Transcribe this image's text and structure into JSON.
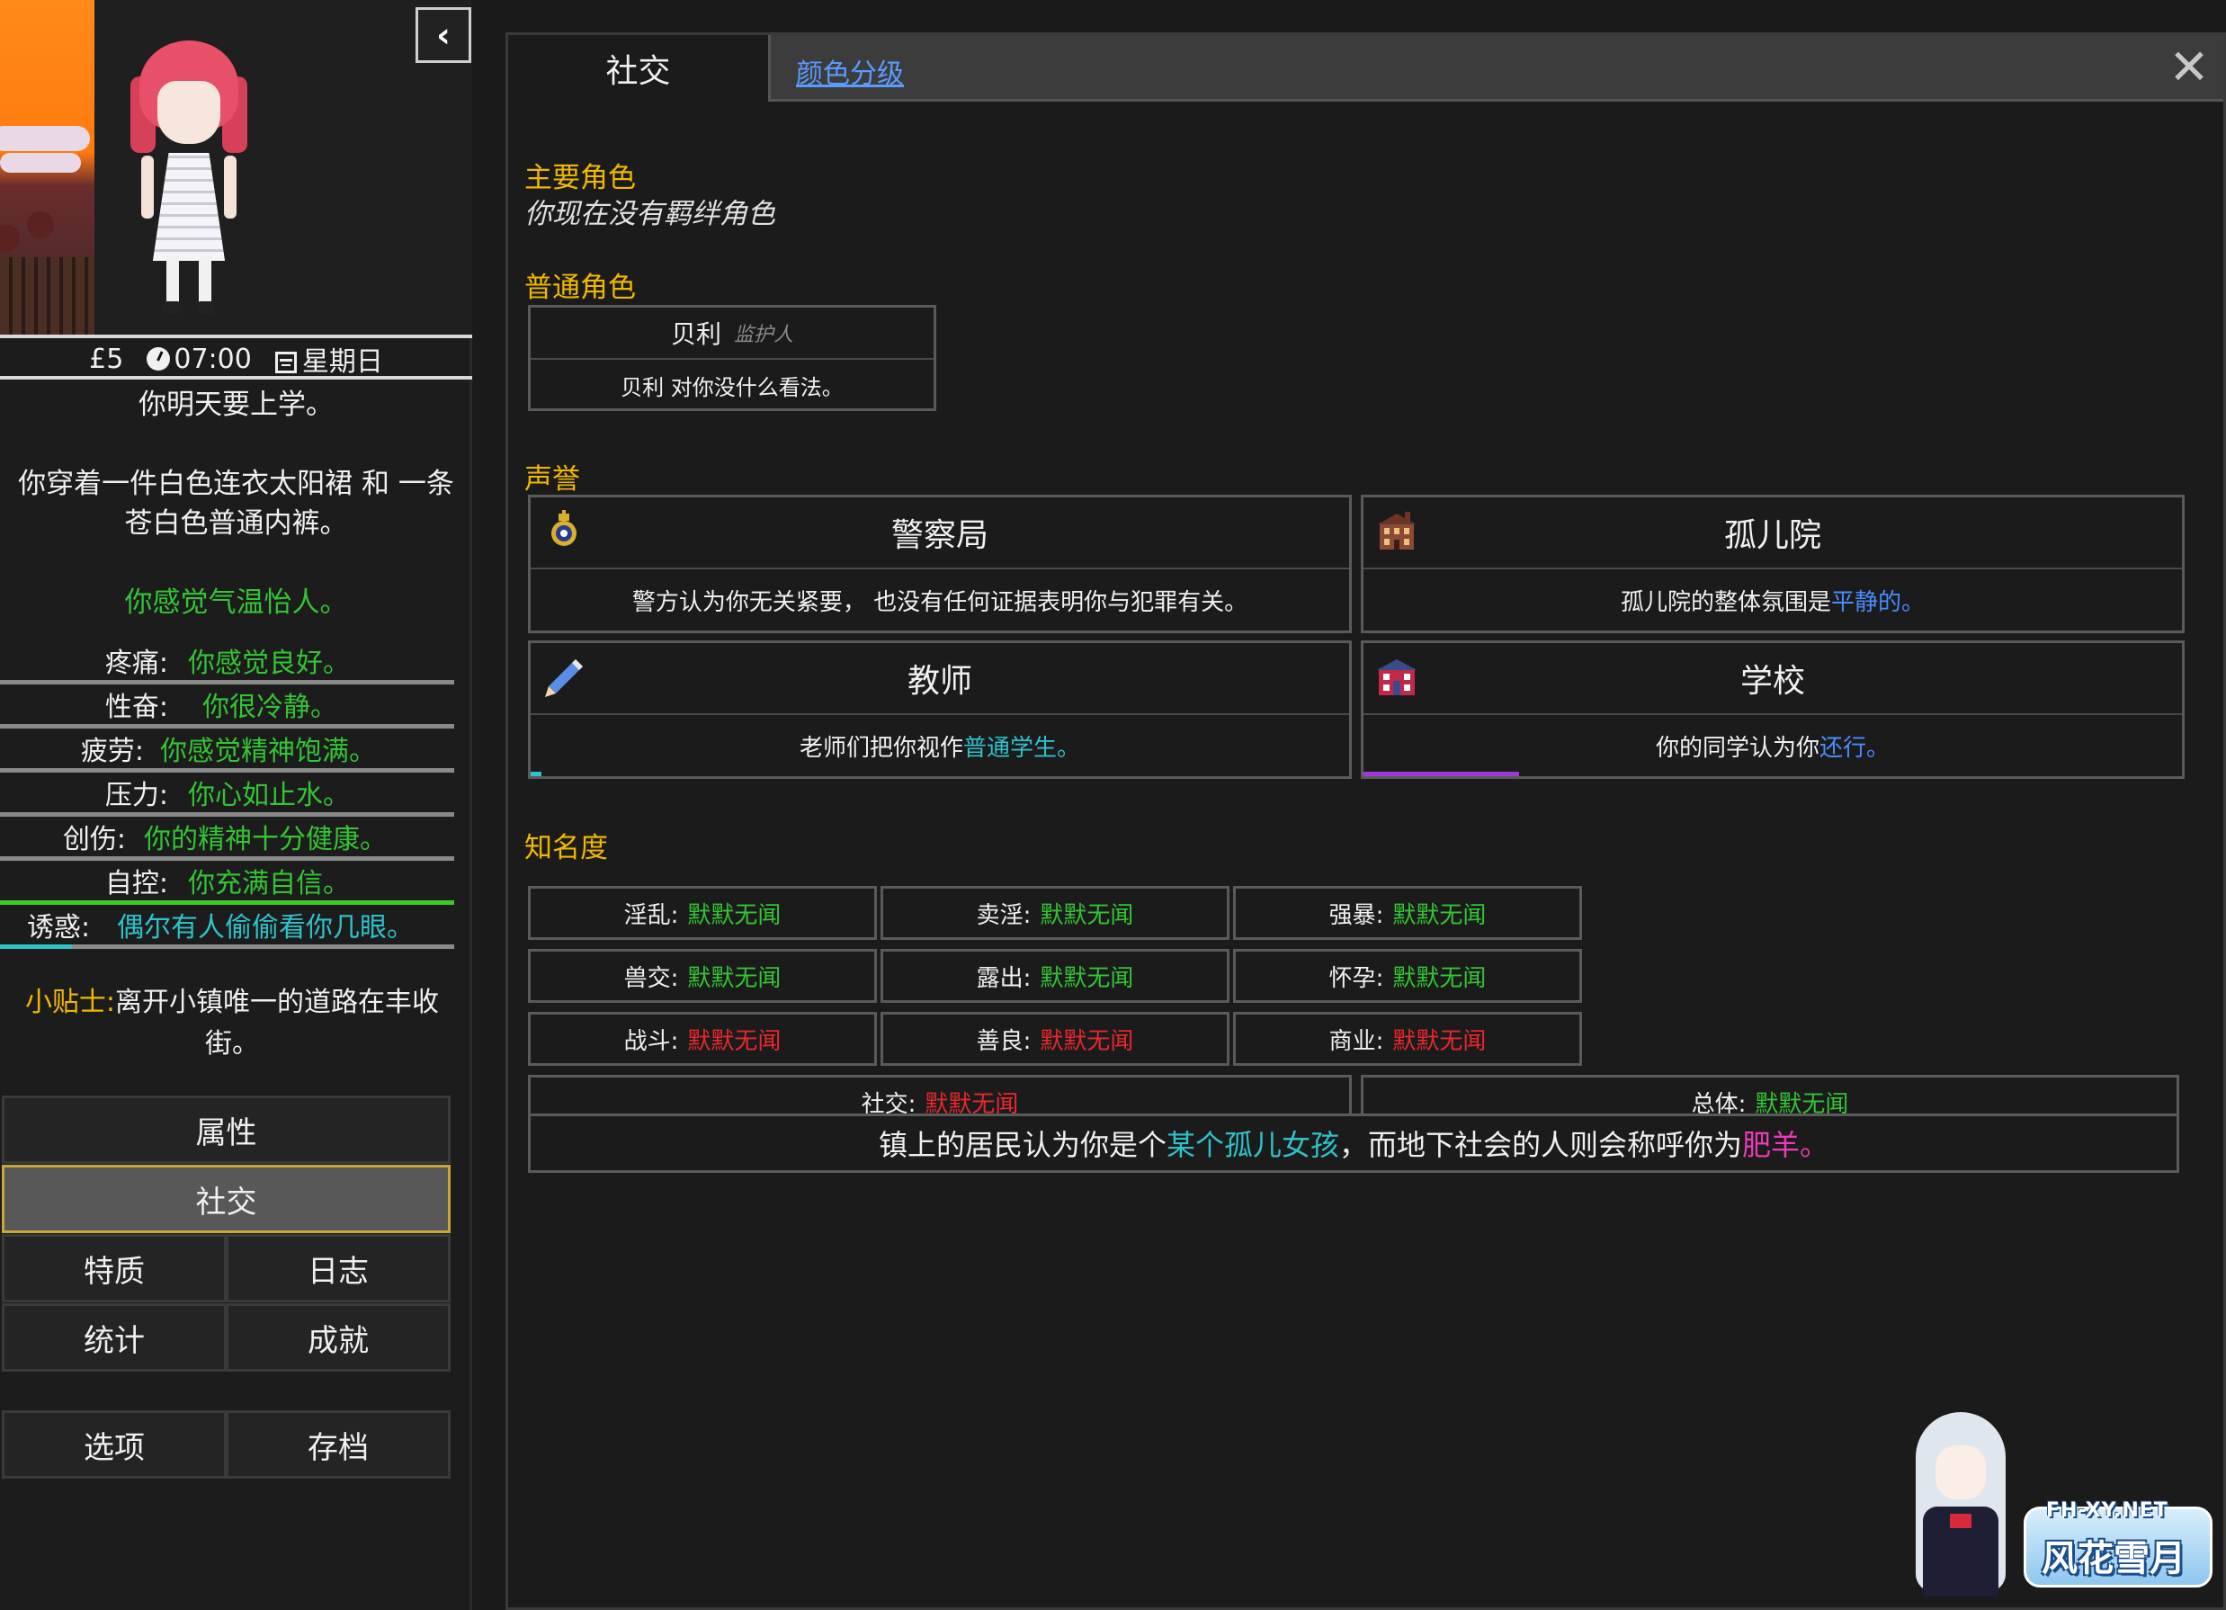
{
  "status": {
    "money": "£5",
    "time": "07:00",
    "weekday": "星期日"
  },
  "narration": {
    "line1": "你明天要上学。",
    "clothing": "你穿着一件白色连衣太阳裙 和 一条苍白色普通内裤。",
    "weather": "你感觉气温怡人。"
  },
  "stats": [
    {
      "label": "疼痛:",
      "value": "你感觉良好。"
    },
    {
      "label": "性奋:",
      "value": "你很冷静。"
    },
    {
      "label": "疲劳:",
      "value": "你感觉精神饱满。"
    },
    {
      "label": "压力:",
      "value": "你心如止水。"
    },
    {
      "label": "创伤:",
      "value": "你的精神十分健康。"
    },
    {
      "label": "自控:",
      "value": "你充满自信。"
    },
    {
      "label": "诱惑:",
      "value": "偶尔有人偷偷看你几眼。"
    }
  ],
  "tip": {
    "label": "小贴士:",
    "text": "离开小镇唯一的道路在丰收街。"
  },
  "menu": {
    "attributes": "属性",
    "social": "社交",
    "traits": "特质",
    "journal": "日志",
    "statistics": "统计",
    "achievements": "成就",
    "options": "选项",
    "saves": "存档"
  },
  "tabs": {
    "social": "社交",
    "color_grade": "颜色分级"
  },
  "sections": {
    "main_characters": "主要角色",
    "no_bond": "你现在没有羁绊角色",
    "common_characters": "普通角色",
    "reputation": "声誉",
    "fame": "知名度"
  },
  "npc": {
    "name": "贝利",
    "role": "监护人",
    "opinion": "贝利 对你没什么看法。"
  },
  "reputation": [
    {
      "name": "警察局",
      "desc": "警方认为你无关紧要， 也没有任何证据表明你与犯罪有关。",
      "icon": "police-badge-icon"
    },
    {
      "name": "孤儿院",
      "desc_prefix": "孤儿院的整体氛围是 ",
      "desc_value": "平静的。",
      "icon": "orphanage-building-icon"
    },
    {
      "name": "教师",
      "desc_prefix": "老师们把你视作 ",
      "desc_value": "普通学生。",
      "icon": "pencil-icon",
      "level": 0.013
    },
    {
      "name": "学校",
      "desc_prefix": "你的同学认为你 ",
      "desc_value": "还行。",
      "icon": "school-building-icon",
      "level": 0.19
    }
  ],
  "fame": [
    {
      "label": "淫乱:",
      "value": "默默无闻",
      "color": "green"
    },
    {
      "label": "卖淫:",
      "value": "默默无闻",
      "color": "green"
    },
    {
      "label": "强暴:",
      "value": "默默无闻",
      "color": "green"
    },
    {
      "label": "兽交:",
      "value": "默默无闻",
      "color": "green"
    },
    {
      "label": "露出:",
      "value": "默默无闻",
      "color": "green"
    },
    {
      "label": "怀孕:",
      "value": "默默无闻",
      "color": "green"
    },
    {
      "label": "战斗:",
      "value": "默默无闻",
      "color": "red"
    },
    {
      "label": "善良:",
      "value": "默默无闻",
      "color": "red"
    },
    {
      "label": "商业:",
      "value": "默默无闻",
      "color": "red"
    },
    {
      "label": "社交:",
      "value": "默默无闻",
      "color": "red"
    },
    {
      "label": "总体:",
      "value": "默默无闻",
      "color": "green"
    }
  ],
  "summary": {
    "prefix": "镇上的居民认为你是个",
    "town_title": "某个孤儿女孩",
    "middle": "，而地下社会的人则会称呼你为",
    "underworld_title": "肥羊",
    "end": "。"
  },
  "watermark": {
    "site": "FH-XY.NET",
    "name": "风花雪月"
  },
  "colors": {
    "gold": "#f0b800",
    "green": "#33c533",
    "cyan": "#2ec2c9",
    "blue": "#4a8cff",
    "red": "#e8282c",
    "pink": "#ec3bb6",
    "link": "#5a9bff"
  }
}
